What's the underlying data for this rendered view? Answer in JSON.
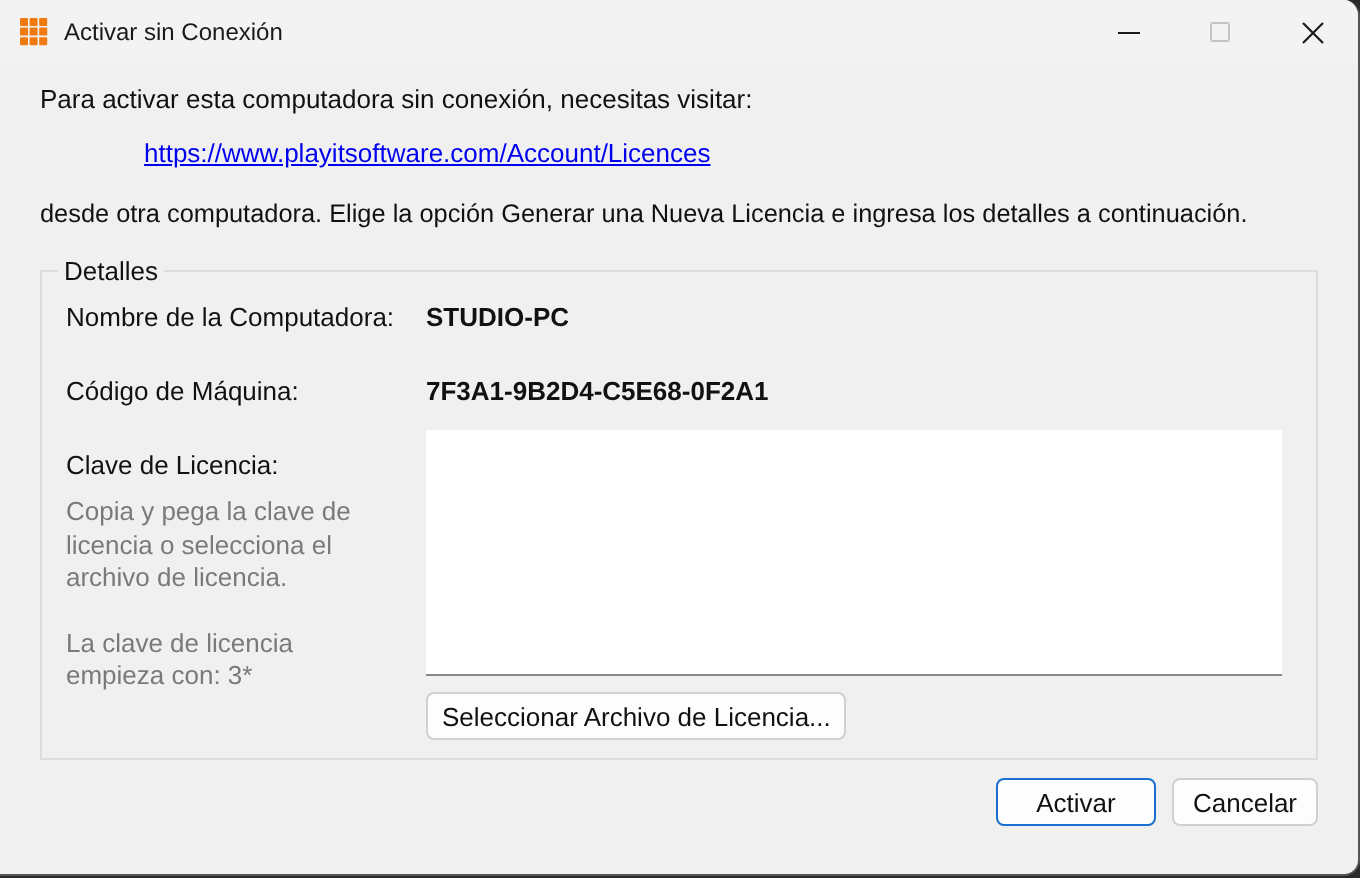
{
  "window": {
    "title": "Activar sin Conexión",
    "controls": [
      {
        "kind": "minimize",
        "disabled": false
      },
      {
        "kind": "maximize",
        "disabled": true
      },
      {
        "kind": "close",
        "disabled": false
      }
    ]
  },
  "intro": "Para activar esta computadora sin conexión, necesitas visitar:",
  "link": "https://www.playitsoftware.com/Account/Licences",
  "instructions": "desde otra computadora. Elige la opción Generar una Nueva Licencia e ingresa los detalles a continuación.",
  "details": {
    "title": "Detalles",
    "fields": [
      {
        "label": "Nombre de la Computadora:",
        "value": "STUDIO-PC"
      },
      {
        "label": "Código de Máquina:",
        "value": "7F3A1-9B2D4-C5E68-0F2A1"
      }
    ],
    "license": {
      "label": "Clave de Licencia:",
      "hints": [
        "Copia y pega la clave de licencia o selecciona el archivo de licencia.",
        "La clave de licencia empieza con: 3*"
      ],
      "select_button": "Seleccionar Archivo de Licencia..."
    }
  },
  "buttons": [
    {
      "label": "Activar",
      "default": true
    },
    {
      "label": "Cancelar",
      "default": false
    }
  ]
}
